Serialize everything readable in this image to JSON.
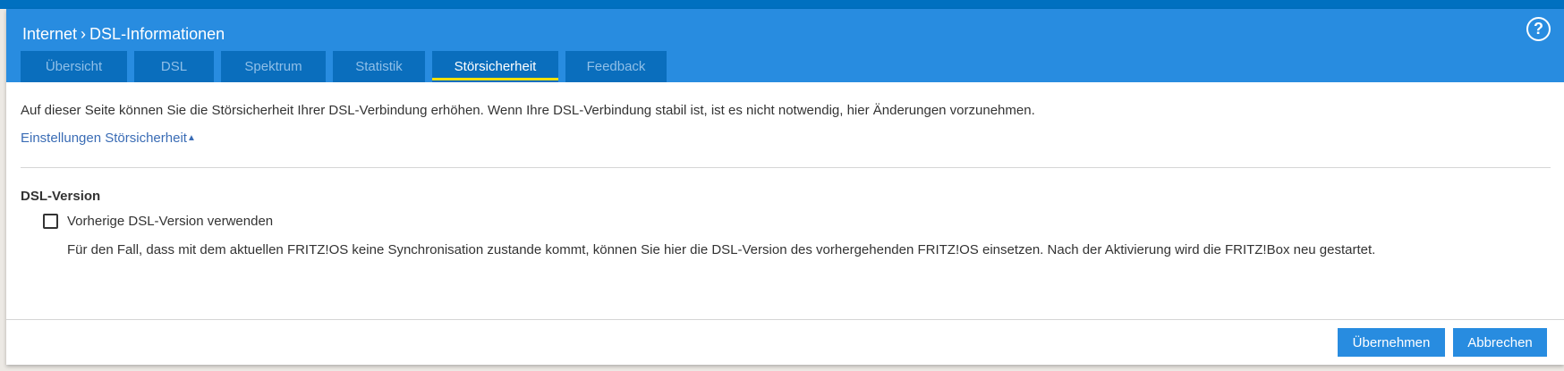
{
  "header": {
    "breadcrumb_parent": "Internet",
    "breadcrumb_sep": "›",
    "breadcrumb_current": "DSL-Informationen",
    "help_icon": "?"
  },
  "tabs": [
    {
      "label": "Übersicht"
    },
    {
      "label": "DSL"
    },
    {
      "label": "Spektrum"
    },
    {
      "label": "Statistik"
    },
    {
      "label": "Störsicherheit",
      "active": true
    },
    {
      "label": "Feedback"
    }
  ],
  "content": {
    "intro": "Auf dieser Seite können Sie die Störsicherheit Ihrer DSL-Verbindung erhöhen. Wenn Ihre DSL-Verbindung stabil ist, ist es nicht notwendig, hier Änderungen vorzunehmen.",
    "settings_link": "Einstellungen Störsicherheit",
    "settings_arrow": "▲",
    "section_title": "DSL-Version",
    "checkbox_label": "Vorherige DSL-Version verwenden",
    "checkbox_checked": false,
    "description": "Für den Fall, dass mit dem aktuellen FRITZ!OS keine Synchronisation zustande kommt, können Sie hier die DSL-Version des vorhergehenden FRITZ!OS einsetzen. Nach der Aktivierung wird die FRITZ!Box neu gestartet."
  },
  "footer": {
    "apply_label": "Übernehmen",
    "cancel_label": "Abbrechen"
  },
  "colors": {
    "header": "#288ce0",
    "tab": "#0a6ebd",
    "active_underline": "#f0e000",
    "link": "#3a6cb5"
  }
}
